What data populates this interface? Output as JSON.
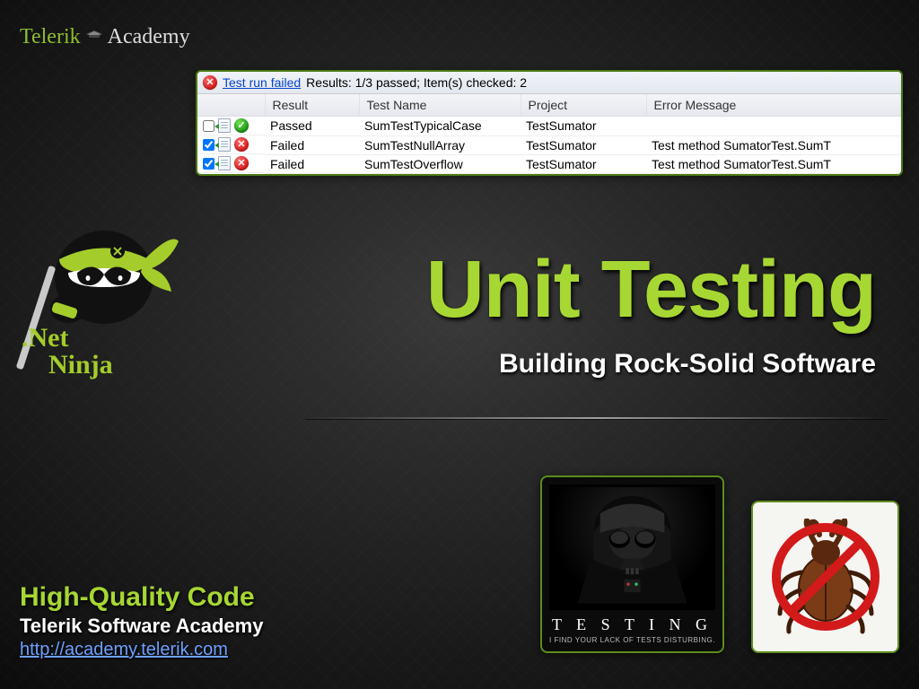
{
  "logo": {
    "word1": "Telerik",
    "word2": "Academy"
  },
  "test_panel": {
    "status_link": "Test run failed",
    "status_rest": "Results: 1/3 passed;  Item(s) checked: 2",
    "columns": {
      "result": "Result",
      "testname": "Test Name",
      "project": "Project",
      "error": "Error Message"
    },
    "rows": [
      {
        "checked": false,
        "passed": true,
        "result": "Passed",
        "name": "SumTestTypicalCase",
        "project": "TestSumator",
        "error": ""
      },
      {
        "checked": true,
        "passed": false,
        "result": "Failed",
        "name": "SumTestNullArray",
        "project": "TestSumator",
        "error": "Test method SumatorTest.SumT"
      },
      {
        "checked": true,
        "passed": false,
        "result": "Failed",
        "name": "SumTestOverflow",
        "project": "TestSumator",
        "error": "Test method SumatorTest.SumT"
      }
    ]
  },
  "ninja": {
    "line1": ".Net",
    "line2": "Ninja"
  },
  "title": "Unit Testing",
  "subtitle": "Building Rock-Solid Software",
  "footer": {
    "hq": "High-Quality Code",
    "org": "Telerik Software Academy",
    "url": "http://academy.telerik.com"
  },
  "poster": {
    "caption": "T E S T I N G",
    "sub": "I FIND YOUR LACK OF TESTS DISTURBING."
  }
}
